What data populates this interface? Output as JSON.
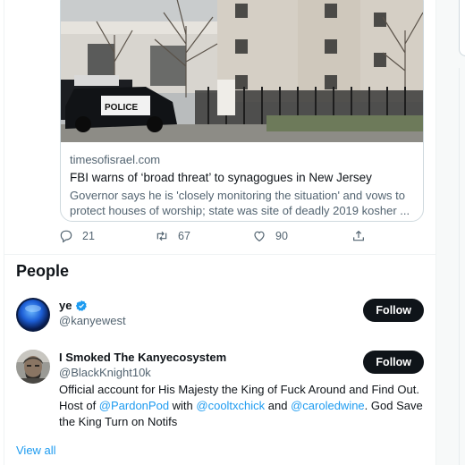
{
  "article_card": {
    "domain": "timesofisrael.com",
    "headline": "FBI warns of ‘broad threat’ to synagogues in New Jersey",
    "description": "Governor says he is 'closely monitoring the situation' and vows to protect houses of worship; state was site of deadly 2019 kosher ...",
    "image_caption_text": "POLICE"
  },
  "tweet_actions": {
    "replies": "21",
    "retweets": "67",
    "likes": "90"
  },
  "people": {
    "title": "People",
    "items": [
      {
        "name": "ye",
        "handle": "@kanyewest",
        "verified": true,
        "follow_label": "Follow"
      },
      {
        "name": "I Smoked The Kanyecosystem",
        "handle": "@BlackKnight10k",
        "verified": false,
        "follow_label": "Follow",
        "bio_part1": "Official account for His Majesty the King of Fuck Around and Find Out. Host of ",
        "bio_mention1": "@PardonPod",
        "bio_part2": " with ",
        "bio_mention2": "@cooltxchick",
        "bio_part3": " and ",
        "bio_mention3": "@caroledwine",
        "bio_part4": ". God Save the King Turn on Notifs"
      }
    ],
    "view_all": "View all"
  },
  "colors": {
    "accent": "#1d9bf0",
    "text": "#0f1419",
    "secondary": "#536471",
    "border": "#cfd9de"
  }
}
